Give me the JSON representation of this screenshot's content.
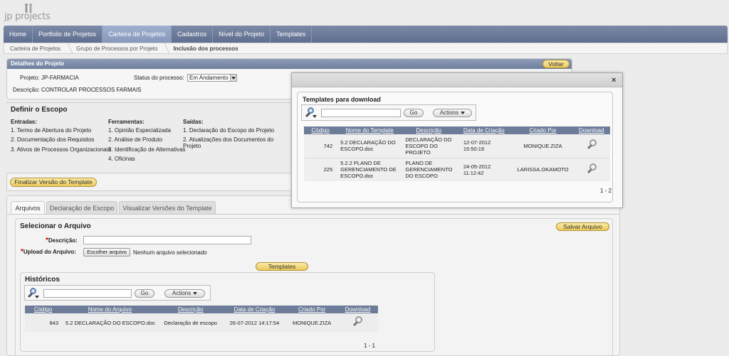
{
  "brand": {
    "logo_text": "jp projects"
  },
  "nav": [
    "Home",
    "Portfolio de Projetos",
    "Carteira de Projetos",
    "Cadastros",
    "Nível do Projeto",
    "Templates"
  ],
  "breadcrumb": [
    "Carteira de Projetos",
    "Grupo de Processos por Projeto",
    "Inclusão dos processos"
  ],
  "details": {
    "title": "Detalhes do Projeto",
    "back_button": "Voltar",
    "projeto_label": "Projeto:",
    "projeto_value": "JP-FARMACIA",
    "status_label": "Status do processo:",
    "status_value": "Em Andamento",
    "descricao_label": "Descrição:",
    "descricao_value": "CONTROLAR PROCESSOS FARMAIS"
  },
  "escopo": {
    "title": "Definir o Escopo",
    "entradas_title": "Entradas:",
    "entradas": [
      "1. Termo de Abertura do Projeto",
      "2. Documentação dos Requisitos",
      "3. Ativos de Processos Organizacionais"
    ],
    "ferramentas_title": "Ferramentas:",
    "ferramentas": [
      "1. Opinião Especializada",
      "2. Análise de Produto",
      "3. Identificação de Alternativas",
      "4. Oficinas"
    ],
    "saidas_title": "Saídas:",
    "saidas": [
      "1. Declaração do Escopo do Projeto",
      "2. Atualizações dos Documentos do Projeto"
    ]
  },
  "finalizar_button": "Finalizar Versão do Template",
  "tabs": [
    "Arquivos",
    "Declaração de Escopo",
    "Visualizar Versões do Template"
  ],
  "arquivo": {
    "title": "Selecionar o Arquivo",
    "salvar_button": "Salvar Arquivo",
    "required_mark": "*",
    "descricao_label": "Descrição:",
    "upload_label": "Upload do Arquivo:",
    "choose_button": "Escolher arquivo",
    "no_file": "Nenhum arquivo selecionado",
    "templates_button": "Templates"
  },
  "historicos": {
    "title": "Históricos",
    "go_button": "Go",
    "actions_button": "Actions",
    "columns": [
      "Código",
      "Nome do Arquivo",
      "Descrição",
      "Data de Criação",
      "Criado Por",
      "Download"
    ],
    "rows": [
      {
        "codigo": "843",
        "nome": "5.2 DECLARAÇÃO DO ESCOPO.doc",
        "descricao": "Declaração de escopo",
        "data": "26-07-2012 14:17:54",
        "criado": "MONIQUE.ZIZA"
      }
    ],
    "pagination": "1 - 1"
  },
  "modal": {
    "close": "×",
    "title": "Templates para download",
    "go_button": "Go",
    "actions_button": "Actions",
    "columns": [
      "Código",
      "Nome do Template",
      "Descrição",
      "Data de Criação",
      "Criado Por",
      "Download"
    ],
    "rows": [
      {
        "codigo": "742",
        "nome": "5.2 DECLARAÇÃO DO ESCOPO.doc",
        "descricao": "DECLARAÇÃO DO ESCOPO DO PROJETO",
        "data": "12-07-2012 15:50:19",
        "criado": "MONIQUE.ZIZA"
      },
      {
        "codigo": "225",
        "nome": "5.2.2 PLANO DE GERENCIAMENTO DE ESCOPO.doc",
        "descricao": "PLANO DE GERENCIAMENTO DO ESCOPO",
        "data": "24-05-2012 11:12:42",
        "criado": "LARISSA.OKAMOTO"
      }
    ],
    "pagination": "1 - 2"
  }
}
